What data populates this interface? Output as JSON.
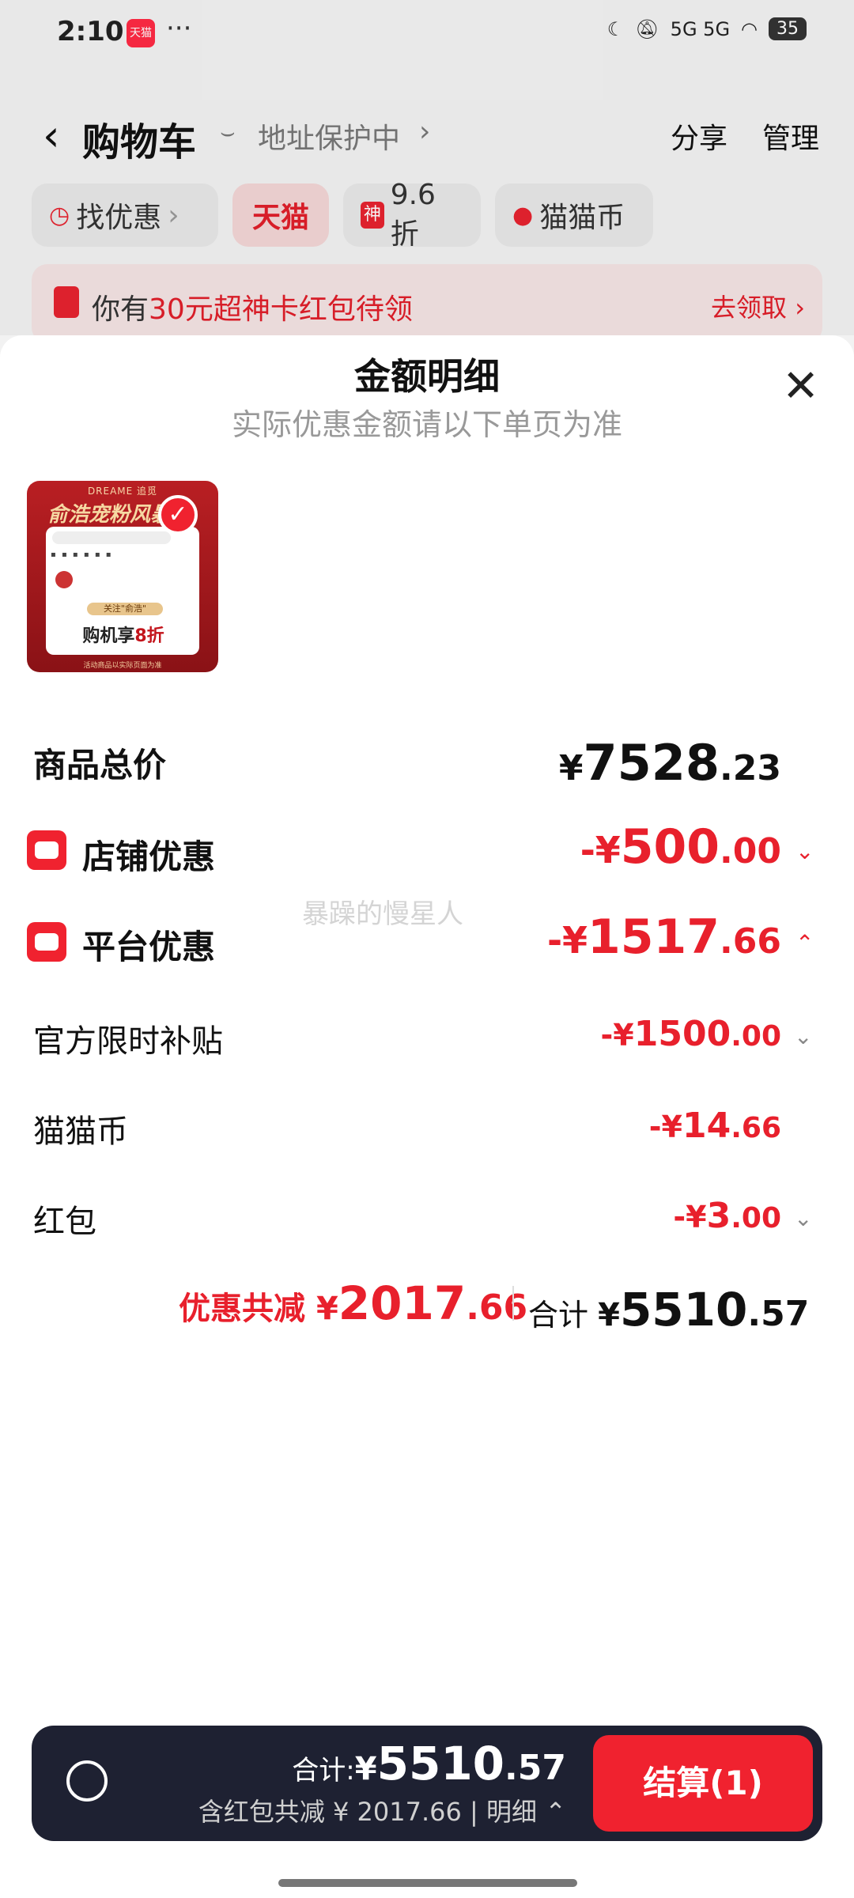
{
  "status_bar": {
    "time": "2:10",
    "app_badge": "天猫",
    "dots": "···",
    "signal": "5G 5G",
    "battery": "35",
    "accent": "#f0222f"
  },
  "header": {
    "title": "购物车",
    "address": "地址保护中",
    "share": "分享",
    "manage": "管理"
  },
  "chips": [
    {
      "label": "找优惠",
      "icon": "timer-icon"
    },
    {
      "label": "天猫"
    },
    {
      "badge": "神",
      "label": "9.6折"
    },
    {
      "label": "猫猫币",
      "icon": "cat-coin-icon"
    }
  ],
  "banner": {
    "pre": "你有",
    "highlight": "30元超神卡红包待领",
    "link": "去领取"
  },
  "sheet": {
    "title": "金额明细",
    "subtitle": "实际优惠金额请以下单页为准",
    "product": {
      "brand": "DREAME 追觅",
      "slogan": "俞浩宠粉风暴",
      "follow_tag": "关注\"俞浩\"",
      "promo_pre": "购机享",
      "promo_highlight": "8折",
      "foot": "活动商品以实际页面为准"
    },
    "rows": {
      "total_price": {
        "label": "商品总价",
        "yen": "¥",
        "int": "7528",
        "dec": ".23"
      },
      "shop_discount": {
        "label": "店铺优惠",
        "prefix": "-¥",
        "int": "500",
        "dec": ".00"
      },
      "platform_discount": {
        "label": "平台优惠",
        "prefix": "-¥",
        "int": "1517",
        "dec": ".66"
      },
      "subsidy": {
        "label": "官方限时补贴",
        "prefix": "-¥",
        "int": "1500",
        "dec": ".00"
      },
      "coins": {
        "label": "猫猫币",
        "prefix": "-¥",
        "int": "14",
        "dec": ".66"
      },
      "hongbao": {
        "label": "红包",
        "prefix": "-¥",
        "int": "3",
        "dec": ".00"
      }
    },
    "watermark": "暴躁的慢星人",
    "summary": {
      "disc_label": "优惠共减",
      "disc_yen": "¥",
      "disc_int": "2017",
      "disc_dec": ".66",
      "total_label": "合计",
      "total_yen": "¥",
      "total_int": "5510",
      "total_dec": ".57"
    }
  },
  "bottom_bar": {
    "total_label": "合计:",
    "yen": "¥",
    "int": "5510",
    "dec": ".57",
    "sub": "含红包共减 ¥ 2017.66 | 明细",
    "checkout": "结算(1)"
  }
}
